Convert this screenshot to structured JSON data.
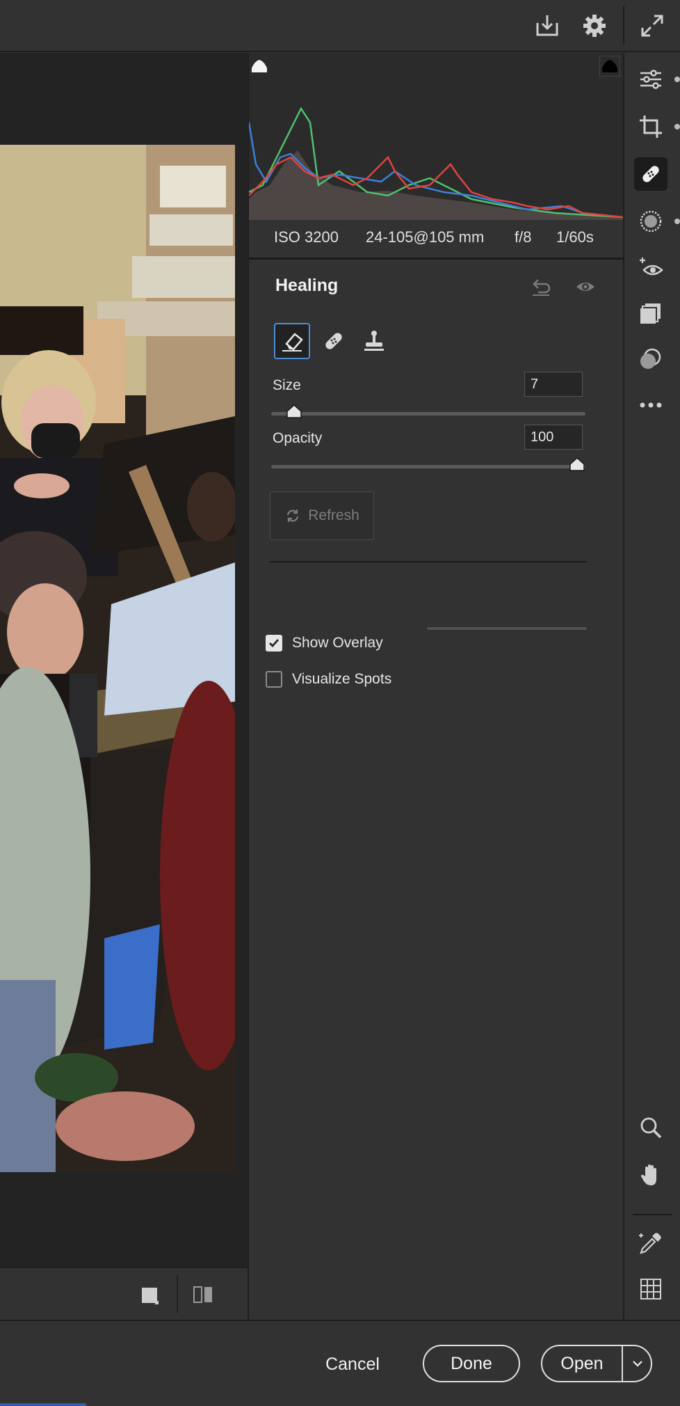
{
  "topbar": {
    "icons": [
      "save-icon",
      "settings-gear-icon",
      "fullscreen-expand-icon"
    ]
  },
  "histogram": {
    "clipping_shadow": "shadow-clipping-icon",
    "clipping_highlight": "highlight-clipping-icon"
  },
  "exif": {
    "iso": "ISO 3200",
    "lens": "24-105@105 mm",
    "aperture": "f/8",
    "shutter": "1/60s"
  },
  "healing": {
    "title": "Healing",
    "tools": [
      "content-aware-remove-icon",
      "heal-bandage-icon",
      "clone-stamp-icon"
    ],
    "size_label": "Size",
    "size_value": "7",
    "size_fraction": 0.05,
    "opacity_label": "Opacity",
    "opacity_value": "100",
    "opacity_fraction": 1.0,
    "refresh_label": "Refresh",
    "show_overlay_label": "Show Overlay",
    "show_overlay_checked": true,
    "visualize_spots_label": "Visualize Spots",
    "visualize_spots_checked": false
  },
  "toolbar": {
    "items": [
      "edit-sliders-icon",
      "crop-icon",
      "healing-bandage-icon",
      "masking-icon",
      "red-eye-icon",
      "presets-icon",
      "snapshots-icon",
      "more-icon",
      "zoom-icon",
      "hand-icon",
      "color-sampler-icon",
      "grid-icon"
    ]
  },
  "footer": {
    "icons": [
      "view-mode-icon",
      "compare-icon"
    ]
  },
  "actions": {
    "cancel": "Cancel",
    "done": "Done",
    "open": "Open"
  },
  "colors": {
    "background": "#323232",
    "accent": "#4c8eda",
    "histogram_red": "#e0433f",
    "histogram_green": "#4fc26a",
    "histogram_blue": "#3f7fd9"
  }
}
